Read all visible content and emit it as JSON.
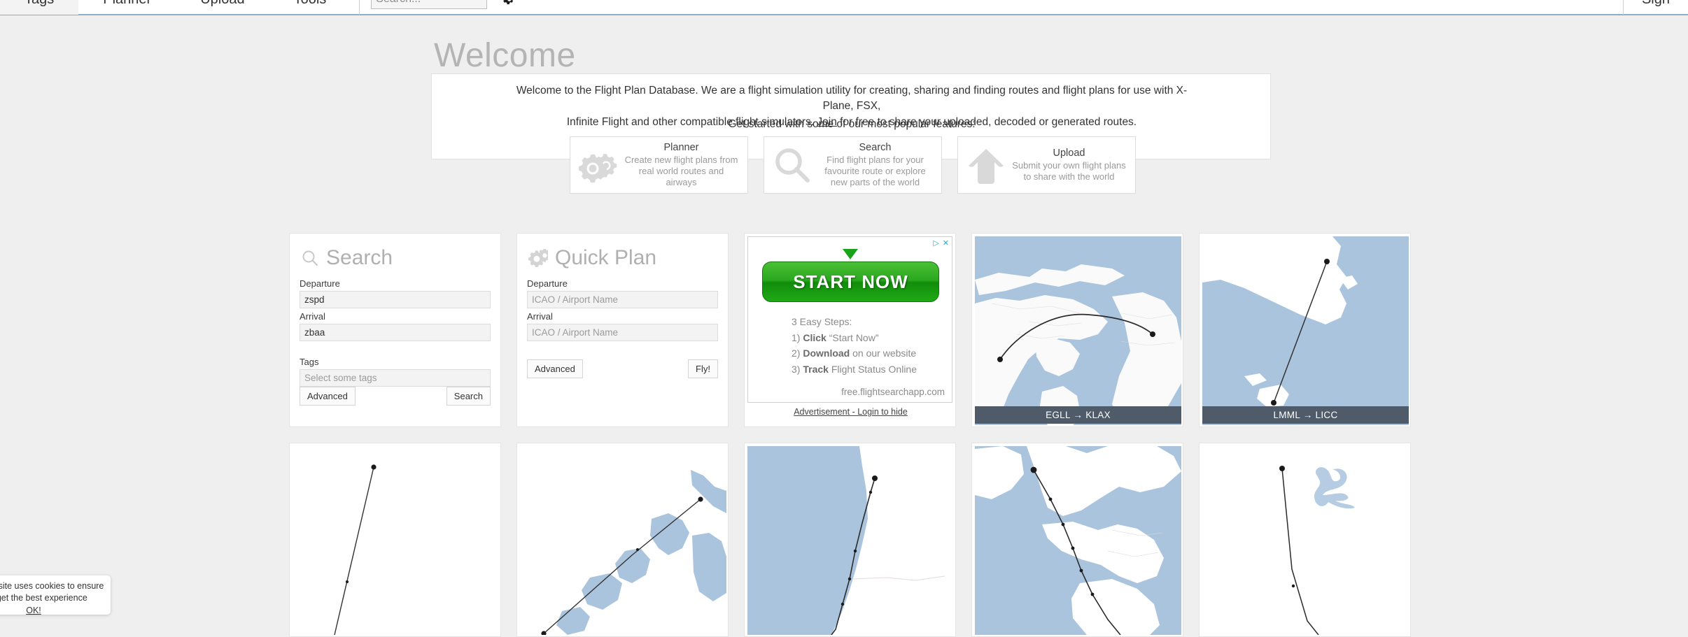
{
  "navbar": {
    "items": [
      {
        "label": "Tags",
        "name": "nav-item-tags"
      },
      {
        "label": "Planner",
        "name": "nav-item-planner"
      },
      {
        "label": "Upload",
        "name": "nav-item-upload"
      },
      {
        "label": "Tools",
        "name": "nav-item-tools"
      }
    ],
    "search": {
      "value": "",
      "placeholder": "Search..."
    },
    "settings_icon": "gear-icon",
    "right_item": "Sign"
  },
  "welcome": {
    "title": "Welcome",
    "intro_line1": "Welcome to the Flight Plan Database. We are a flight simulation utility for creating, sharing and finding routes and flight plans for use with X-Plane, FSX,",
    "intro_line2_before": "Infinite Flight and other compatible flight simulators. ",
    "join_link": "Join",
    "intro_line2_after": " for free to share your uploaded, decoded or generated routes.",
    "features_lead": "Get started with some of our most popular features:",
    "features": [
      {
        "title": "Planner",
        "desc": "Create new flight plans from real world routes and airways",
        "icon": "gears-icon"
      },
      {
        "title": "Search",
        "desc": "Find flight plans for your favourite route or explore new parts of the world",
        "icon": "magnifier-icon"
      },
      {
        "title": "Upload",
        "desc": "Submit your own flight plans to share with the world",
        "icon": "upload-arrow-icon"
      }
    ]
  },
  "search_panel": {
    "title": "Search",
    "title_icon": "magnifier-icon",
    "departure_label": "Departure",
    "departure_value": "zspd",
    "departure_placeholder": "",
    "arrival_label": "Arrival",
    "arrival_value": "zbaa",
    "arrival_placeholder": "",
    "tags_label": "Tags",
    "tags_value": "",
    "tags_placeholder": "Select some tags",
    "advanced_button": "Advanced",
    "submit_button": "Search"
  },
  "quick_plan_panel": {
    "title": "Quick Plan",
    "title_icon": "gears-icon",
    "departure_label": "Departure",
    "departure_value": "",
    "departure_placeholder": "ICAO / Airport Name",
    "arrival_label": "Arrival",
    "arrival_value": "",
    "arrival_placeholder": "ICAO / Airport Name",
    "advanced_button": "Advanced",
    "submit_button": "Fly!"
  },
  "advertisement": {
    "close_icon": "close-icon",
    "adchoices_icon": "adchoices-icon",
    "cta_label": "START NOW",
    "steps_heading": "3 Easy Steps:",
    "step1_num": "1) ",
    "step1_bold": "Click",
    "step1_rest": " “Start Now”",
    "step2_num": "2) ",
    "step2_bold": "Download",
    "step2_rest": " on our website",
    "step3_num": "3) ",
    "step3_bold": "Track",
    "step3_rest": " Flight Status Online",
    "url": "free.flightsearchapp.com",
    "disclaimer": "Advertisement - Login to hide"
  },
  "map_cards": [
    {
      "caption": "EGLL → KLAX",
      "kind": "north-atlantic"
    },
    {
      "caption": "LMML → LICC",
      "kind": "sicily-malta"
    },
    {
      "caption": "",
      "kind": "blank-route"
    },
    {
      "caption": "",
      "kind": "river-coast"
    },
    {
      "caption": "",
      "kind": "west-coast"
    },
    {
      "caption": "",
      "kind": "uk-france"
    },
    {
      "caption": "",
      "kind": "lake-route"
    }
  ],
  "cookie_banner": {
    "line1": "This website uses cookies to ensure",
    "line2": "you get the best experience",
    "ok_label": "OK!"
  },
  "colors": {
    "page_bg": "#efefef",
    "nav_accent": "#8eaec9",
    "map_water": "#aac4de",
    "map_land": "#ffffff",
    "caption_bar": "#4f5b68",
    "ad_green": "#1faa16",
    "title_grey": "#b4b4b4"
  }
}
